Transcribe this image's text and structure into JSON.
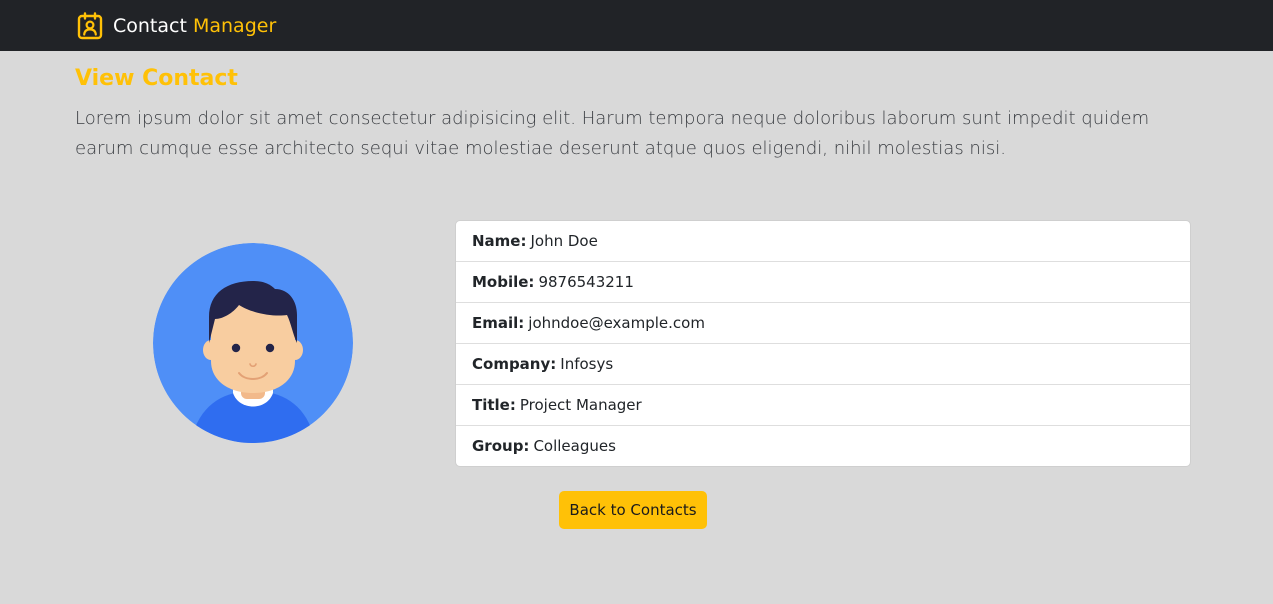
{
  "navbar": {
    "brand_icon": "contact-card-icon",
    "brand_text_primary": "Contact",
    "brand_text_accent": "Manager",
    "accent_color": "#ffc107",
    "background_color": "#212327"
  },
  "page": {
    "title": "View Contact",
    "description": "Lorem ipsum dolor sit amet consectetur adipisicing elit. Harum tempora neque doloribus laborum sunt impedit quidem earum cumque esse architecto sequi vitae molestiae deserunt atque quos eligendi, nihil molestias nisi."
  },
  "avatar": {
    "icon": "user-avatar-icon"
  },
  "contact": {
    "fields": [
      {
        "label": "Name:",
        "value": "John Doe"
      },
      {
        "label": "Mobile:",
        "value": "9876543211"
      },
      {
        "label": "Email:",
        "value": "johndoe@example.com"
      },
      {
        "label": "Company:",
        "value": "Infosys"
      },
      {
        "label": "Title:",
        "value": "Project Manager"
      },
      {
        "label": "Group:",
        "value": "Colleagues"
      }
    ]
  },
  "actions": {
    "back_label": "Back to Contacts"
  }
}
